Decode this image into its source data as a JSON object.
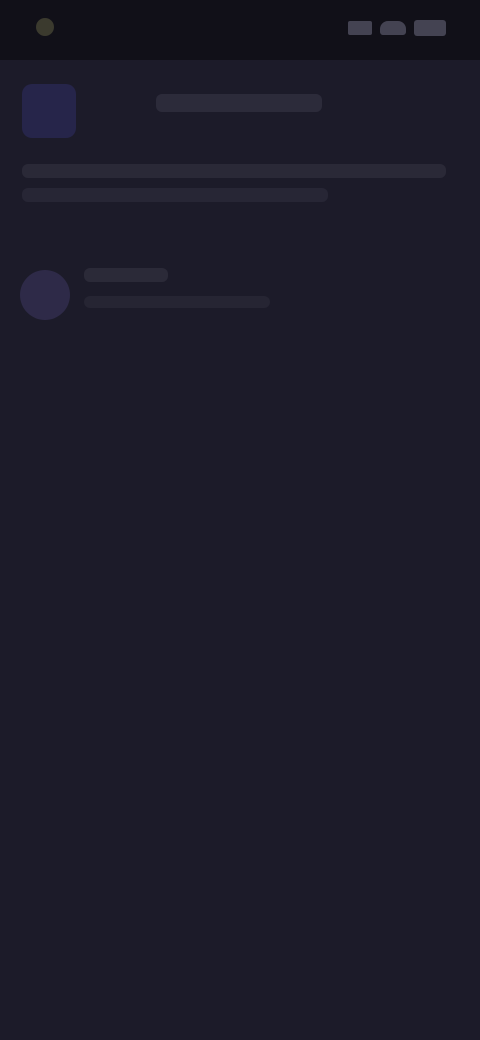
{
  "colors": {
    "background": "#1c1b29",
    "status_bar": "#111018",
    "accent_purple": "#2e2a48"
  },
  "status_bar": {
    "left_icon": "status-dot-icon",
    "right_icons": [
      "signal-icon",
      "wifi-icon",
      "battery-icon"
    ]
  },
  "header": {
    "app_icon": "app-avatar-icon",
    "title": ""
  },
  "banner": {
    "line1": "",
    "line2": ""
  },
  "list": {
    "items": [
      {
        "avatar": "avatar-icon",
        "title": "",
        "subtitle": ""
      }
    ]
  }
}
